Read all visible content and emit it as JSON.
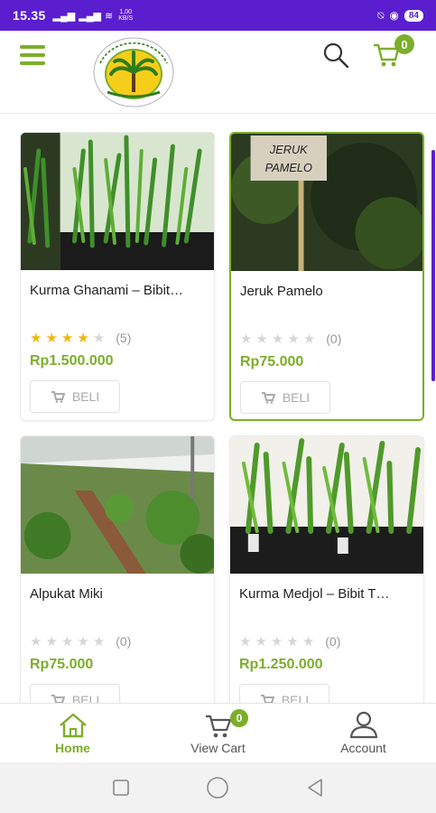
{
  "status_bar": {
    "time": "15.35",
    "speed_value": "1,00",
    "speed_unit": "KB/S",
    "battery": "84"
  },
  "header": {
    "logo_icon": "palm-tree-logo",
    "logo_text": "TDI BIOTECH - NURSERY & FARM",
    "cart_count": "0",
    "colors": {
      "accent": "#7cae2b",
      "status_bar": "#5b1ecf"
    }
  },
  "products": [
    {
      "title": "Kurma Ghanami – Bibit…",
      "rating": 4,
      "review_count": "(5)",
      "price": "Rp1.500.000",
      "buy_label": "BELI",
      "selected": false
    },
    {
      "title": "Jeruk Pamelo",
      "rating": 0,
      "review_count": "(0)",
      "price": "Rp75.000",
      "buy_label": "BELI",
      "selected": true,
      "image_sign_text": "JERUK PAMELO"
    },
    {
      "title": "Alpukat Miki",
      "rating": 0,
      "review_count": "(0)",
      "price": "Rp75.000",
      "buy_label": "BELI",
      "selected": false
    },
    {
      "title": "Kurma Medjol – Bibit T…",
      "rating": 0,
      "review_count": "(0)",
      "price": "Rp1.250.000",
      "buy_label": "BELI",
      "selected": false
    }
  ],
  "bottom_nav": {
    "home_label": "Home",
    "cart_label": "View Cart",
    "cart_count": "0",
    "account_label": "Account"
  }
}
